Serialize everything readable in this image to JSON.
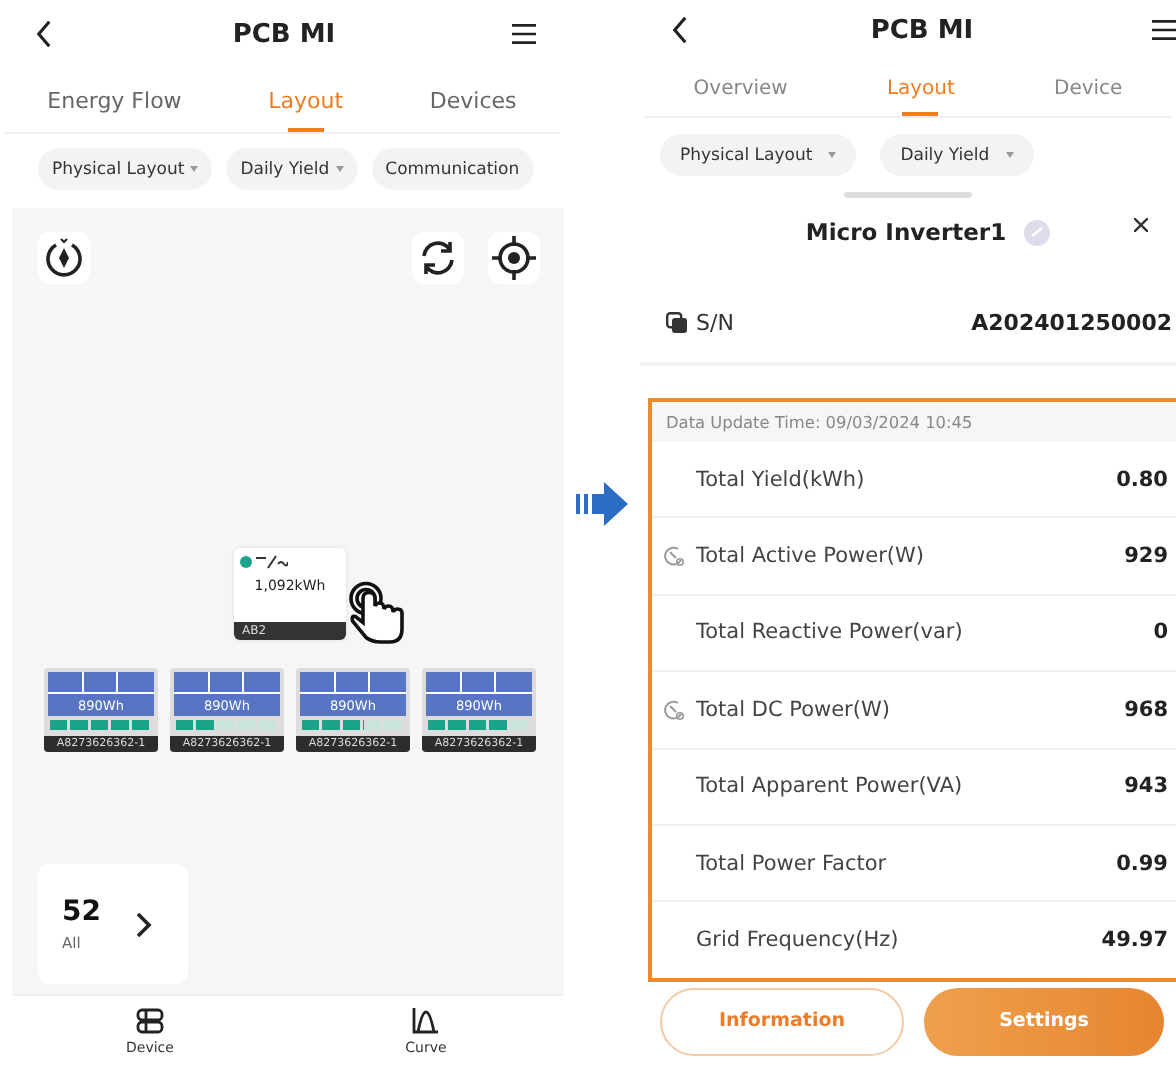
{
  "left": {
    "title": "PCB MI",
    "tabs": [
      {
        "label": "Energy Flow",
        "selected": false
      },
      {
        "label": "Layout",
        "selected": true
      },
      {
        "label": "Devices",
        "selected": false
      }
    ],
    "filters": [
      "Physical Layout",
      "Daily Yield",
      "Communication"
    ],
    "inverter": {
      "yield": "1,092kWh",
      "serial": "AB2"
    },
    "panels": [
      {
        "yield": "890Wh",
        "level": 1,
        "serial": "A8273626362-1"
      },
      {
        "yield": "890Wh",
        "level": 0.4,
        "serial": "A8273626362-1"
      },
      {
        "yield": "890Wh",
        "level": 0.6,
        "serial": "A8273626362-1"
      },
      {
        "yield": "890Wh",
        "level": 0.8,
        "serial": "A8273626362-1"
      }
    ],
    "count": {
      "value": "52",
      "label": "All"
    },
    "nav": [
      "Device",
      "Curve"
    ]
  },
  "right": {
    "title": "PCB MI",
    "tabs": [
      {
        "label": "Overview",
        "selected": false
      },
      {
        "label": "Layout",
        "selected": true
      },
      {
        "label": "Device",
        "selected": false
      }
    ],
    "filters": [
      "Physical Layout",
      "Daily Yield"
    ],
    "device": {
      "name": "Micro Inverter1",
      "sn_label": "S/N",
      "sn": "A202401250002"
    },
    "update_time": "Data Update Time: 09/03/2024 10:45",
    "rows": [
      {
        "kind": "plain",
        "label": "Total Yield(kWh)",
        "value": "0.80"
      },
      {
        "kind": "live",
        "label": "Total Active Power(W)",
        "value": "929"
      },
      {
        "kind": "plain",
        "label": "Total Reactive Power(var)",
        "value": "0"
      },
      {
        "kind": "live",
        "label": "Total DC Power(W)",
        "value": "968"
      },
      {
        "kind": "plain",
        "label": "Total Apparent Power(VA)",
        "value": "943"
      },
      {
        "kind": "plain",
        "label": "Total Power Factor",
        "value": "0.99"
      },
      {
        "kind": "plain",
        "label": "Grid Frequency(Hz)",
        "value": "49.97"
      }
    ],
    "buttons": [
      "Information",
      "Settings"
    ]
  }
}
